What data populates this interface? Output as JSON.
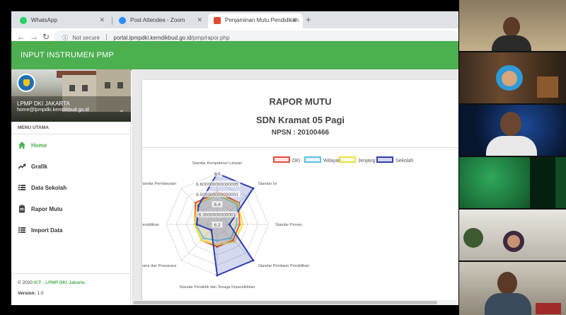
{
  "browser": {
    "tabs": [
      {
        "title": "WhatsApp",
        "icon": "whatsapp-icon",
        "active": false
      },
      {
        "title": "Post Attendee - Zoom",
        "icon": "zoom-icon",
        "active": false
      },
      {
        "title": "Penjaminan Mutu Pendidikan",
        "icon": "site-favicon-icon",
        "active": true
      }
    ],
    "new_tab": "+",
    "not_secure": "Not secure",
    "url_host": "portal.lpmpdki.kemdikbud.go.id",
    "url_path": "/pmp/rapor.php"
  },
  "app": {
    "title": "INPUT INSTRUMEN PMP",
    "accent_color": "#4caf50",
    "profile": {
      "name": "LPMP DKI JAKARTA",
      "email": "home@lpmpdki.kemdikbud.go.id"
    },
    "menu_heading": "MENU UTAMA",
    "menu": [
      {
        "label": "Home",
        "icon": "home-icon",
        "active": true
      },
      {
        "label": "Grafik",
        "icon": "trending-icon",
        "active": false
      },
      {
        "label": "Data Sekolah",
        "icon": "list-icon",
        "active": false
      },
      {
        "label": "Rapor Mutu",
        "icon": "clipboard-icon",
        "active": false
      },
      {
        "label": "Import Data",
        "icon": "list-icon",
        "active": false
      }
    ],
    "footer": {
      "copyright": "© 2020",
      "org": "ICT - LPMP DKI Jakarta",
      "dot": ".",
      "version_label": "Version:",
      "version": "1.0"
    }
  },
  "report": {
    "title": "RAPOR MUTU",
    "school": "SDN Kramat 05 Pagi",
    "npsn": "NPSN : 20100466"
  },
  "chart_data": {
    "type": "radar",
    "axes": [
      "Standar Kompetensi Lulusan",
      "Standar Isi",
      "Standar Proses",
      "Standar Penilaian Pendidikan",
      "Standar Pendidik dan Tenaga Kependidikan",
      "Standar Sarana dan Prasarana",
      "Standar Pengelolaan Pendidikan",
      "Standar Pembiayaan"
    ],
    "tick_labels": [
      "6.2",
      "6.3000000000001",
      "6.4",
      "6.500000000000001",
      "6.600000000000005",
      "6.7"
    ],
    "range": [
      6.2,
      6.7
    ],
    "series": [
      {
        "name": "DKI",
        "color": "#e74c3c",
        "fill": "rgba(231,76,60,0.15)",
        "values": [
          6.52,
          6.5,
          6.42,
          6.42,
          6.42,
          6.42,
          6.42,
          6.5
        ]
      },
      {
        "name": "Wilayah",
        "color": "#5bc0de",
        "fill": "rgba(91,192,222,0.15)",
        "values": [
          6.49,
          6.48,
          6.39,
          6.39,
          6.36,
          6.39,
          6.41,
          6.48
        ]
      },
      {
        "name": "Jenjang",
        "color": "#f0e040",
        "fill": "rgba(240,224,64,0.15)",
        "values": [
          6.5,
          6.49,
          6.45,
          6.44,
          6.4,
          6.42,
          6.42,
          6.48
        ]
      },
      {
        "name": "Sekolah",
        "color": "#2f3fb0",
        "fill": "rgba(47,63,176,0.2)",
        "values": [
          6.7,
          6.7,
          6.32,
          6.7,
          6.7,
          6.28,
          6.4,
          6.46
        ]
      }
    ]
  },
  "participants": [
    {
      "name": "participant-1"
    },
    {
      "name": "participant-2"
    },
    {
      "name": "participant-3"
    },
    {
      "name": "participant-4"
    },
    {
      "name": "participant-5"
    },
    {
      "name": "participant-6"
    }
  ]
}
